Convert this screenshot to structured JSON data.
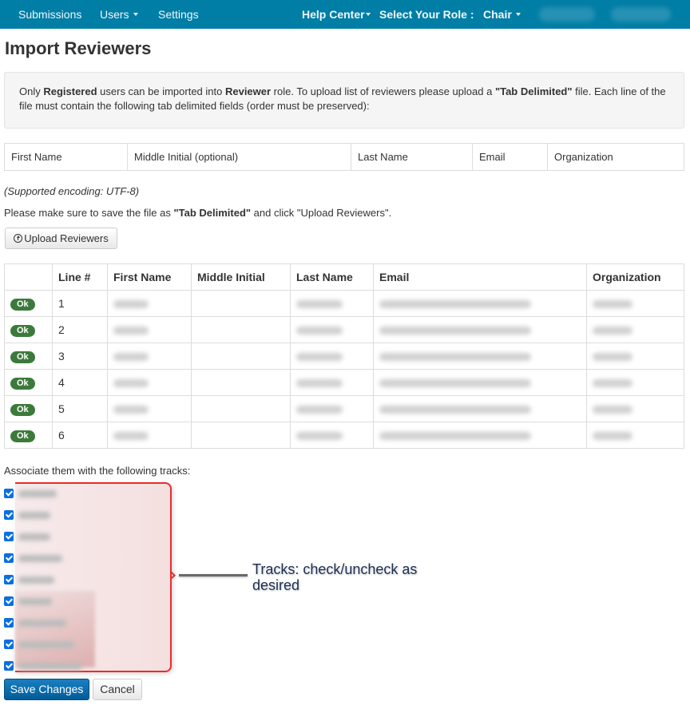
{
  "navbar": {
    "submissions": "Submissions",
    "users": "Users",
    "settings": "Settings",
    "help_center": "Help Center",
    "select_role_label": "Select Your Role :",
    "role": "Chair",
    "accent_color": "#017ea6"
  },
  "page": {
    "title": "Import Reviewers"
  },
  "info": {
    "t1": "Only ",
    "b1": "Registered",
    "t2": " users can be imported into ",
    "b2": "Reviewer",
    "t3": " role. To upload list of reviewers please upload a ",
    "b3": "\"Tab Delimited\"",
    "t4": " file. Each line of the file must contain the following tab delimited fields (order must be preserved):"
  },
  "fields": [
    "First Name",
    "Middle Initial (optional)",
    "Last Name",
    "Email",
    "Organization"
  ],
  "encoding_note": "(Supported encoding: UTF-8)",
  "instructions": {
    "t1": "Please make sure to save the file as ",
    "b1": "\"Tab Delimited\"",
    "t2": " and click \"Upload Reviewers\"."
  },
  "upload_button": "Upload Reviewers",
  "results": {
    "headers": [
      "",
      "Line #",
      "First Name",
      "Middle Initial",
      "Last Name",
      "Email",
      "Organization"
    ],
    "rows": [
      {
        "status": "Ok",
        "line": "1",
        "first": "[redacted]",
        "middle": "",
        "last": "[redacted]",
        "email": "[redacted]",
        "org": "[redacted]"
      },
      {
        "status": "Ok",
        "line": "2",
        "first": "[redacted]",
        "middle": "",
        "last": "[redacted]",
        "email": "[redacted]",
        "org": "[redacted]"
      },
      {
        "status": "Ok",
        "line": "3",
        "first": "[redacted]",
        "middle": "",
        "last": "[redacted]",
        "email": "[redacted]",
        "org": "[redacted]"
      },
      {
        "status": "Ok",
        "line": "4",
        "first": "[redacted]",
        "middle": "",
        "last": "[redacted]",
        "email": "[redacted]",
        "org": "[redacted]"
      },
      {
        "status": "Ok",
        "line": "5",
        "first": "[redacted]",
        "middle": "",
        "last": "[redacted]",
        "email": "[redacted]",
        "org": "[redacted]"
      },
      {
        "status": "Ok",
        "line": "6",
        "first": "[redacted]",
        "middle": "",
        "last": "[redacted]",
        "email": "[redacted]",
        "org": "[redacted]"
      }
    ],
    "ok_color": "#3c7a3c"
  },
  "tracks": {
    "label": "Associate them with the following tracks:",
    "items": [
      {
        "label": "[redacted]",
        "checked": true
      },
      {
        "label": "[redacted]",
        "checked": true
      },
      {
        "label": "[redacted]",
        "checked": true
      },
      {
        "label": "[redacted]",
        "checked": true
      },
      {
        "label": "[redacted]",
        "checked": true
      },
      {
        "label": "[redacted]",
        "checked": true
      },
      {
        "label": "[redacted]",
        "checked": true
      },
      {
        "label": "[redacted]",
        "checked": true
      },
      {
        "label": "[redacted]",
        "checked": true
      }
    ]
  },
  "annotation": "Tracks: check/uncheck as desired",
  "actions": {
    "save": "Save Changes",
    "cancel": "Cancel"
  }
}
